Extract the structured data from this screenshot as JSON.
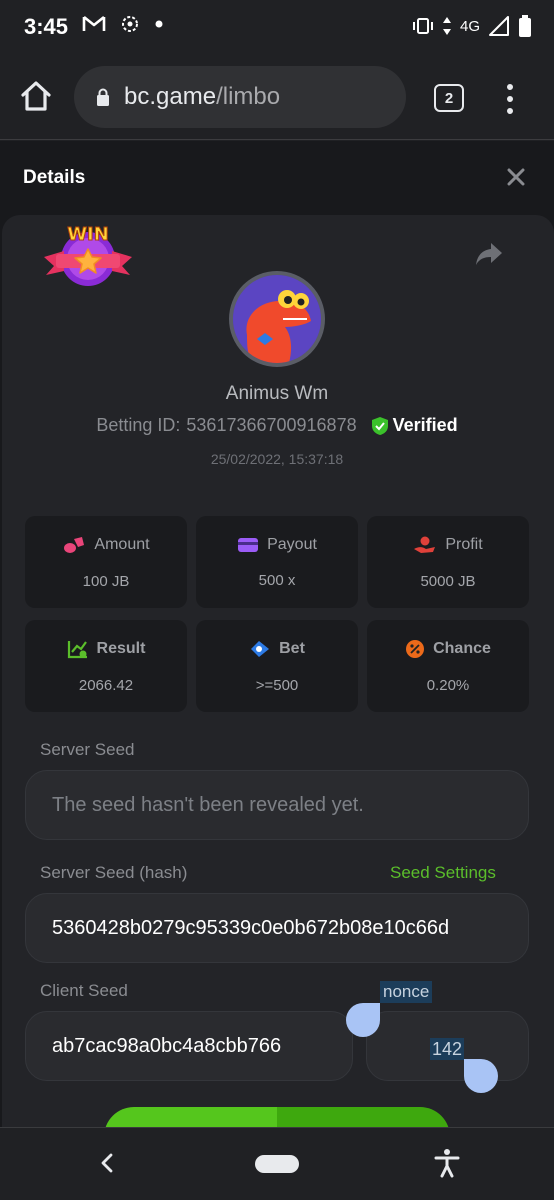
{
  "status_bar": {
    "time": "3:45",
    "network": "4G"
  },
  "browser": {
    "url_host": "bc.game",
    "url_path": "/limbo",
    "tab_count": "2"
  },
  "details": {
    "title": "Details",
    "badge_text": "WIN",
    "username": "Animus Wm",
    "betting_id_label": "Betting ID:",
    "betting_id": "53617366700916878",
    "verified_label": "Verified",
    "timestamp": "25/02/2022, 15:37:18"
  },
  "stats": [
    {
      "label": "Amount",
      "value": "100 JB",
      "icon": "coins-icon",
      "color": "#e9457a"
    },
    {
      "label": "Payout",
      "value": "500 x",
      "icon": "wallet-icon",
      "color": "#9b5cf6"
    },
    {
      "label": "Profit",
      "value": "5000 JB",
      "icon": "hand-coins-icon",
      "color": "#e0413a"
    },
    {
      "label": "Result",
      "value": "2066.42",
      "icon": "chart-check-icon",
      "color": "#5bbe2b"
    },
    {
      "label": "Bet",
      "value": ">=500",
      "icon": "bet-tag-icon",
      "color": "#2d7be5"
    },
    {
      "label": "Chance",
      "value": "0.20%",
      "icon": "percent-icon",
      "color": "#ec6a1a"
    }
  ],
  "seeds": {
    "server_seed_label": "Server Seed",
    "server_seed_value": "The seed hasn't been revealed yet.",
    "server_hash_label": "Server Seed (hash)",
    "seed_settings_label": "Seed Settings",
    "server_hash_value": "5360428b0279c95339c0e0b672b08e10c66d",
    "client_seed_label": "Client Seed",
    "client_seed_value": "ab7cac98a0bc4a8cbb766",
    "nonce_label": "nonce",
    "nonce_value": "142"
  },
  "colors": {
    "accent_green": "#5bbe2b",
    "panel": "#232428",
    "background": "#18191c"
  }
}
